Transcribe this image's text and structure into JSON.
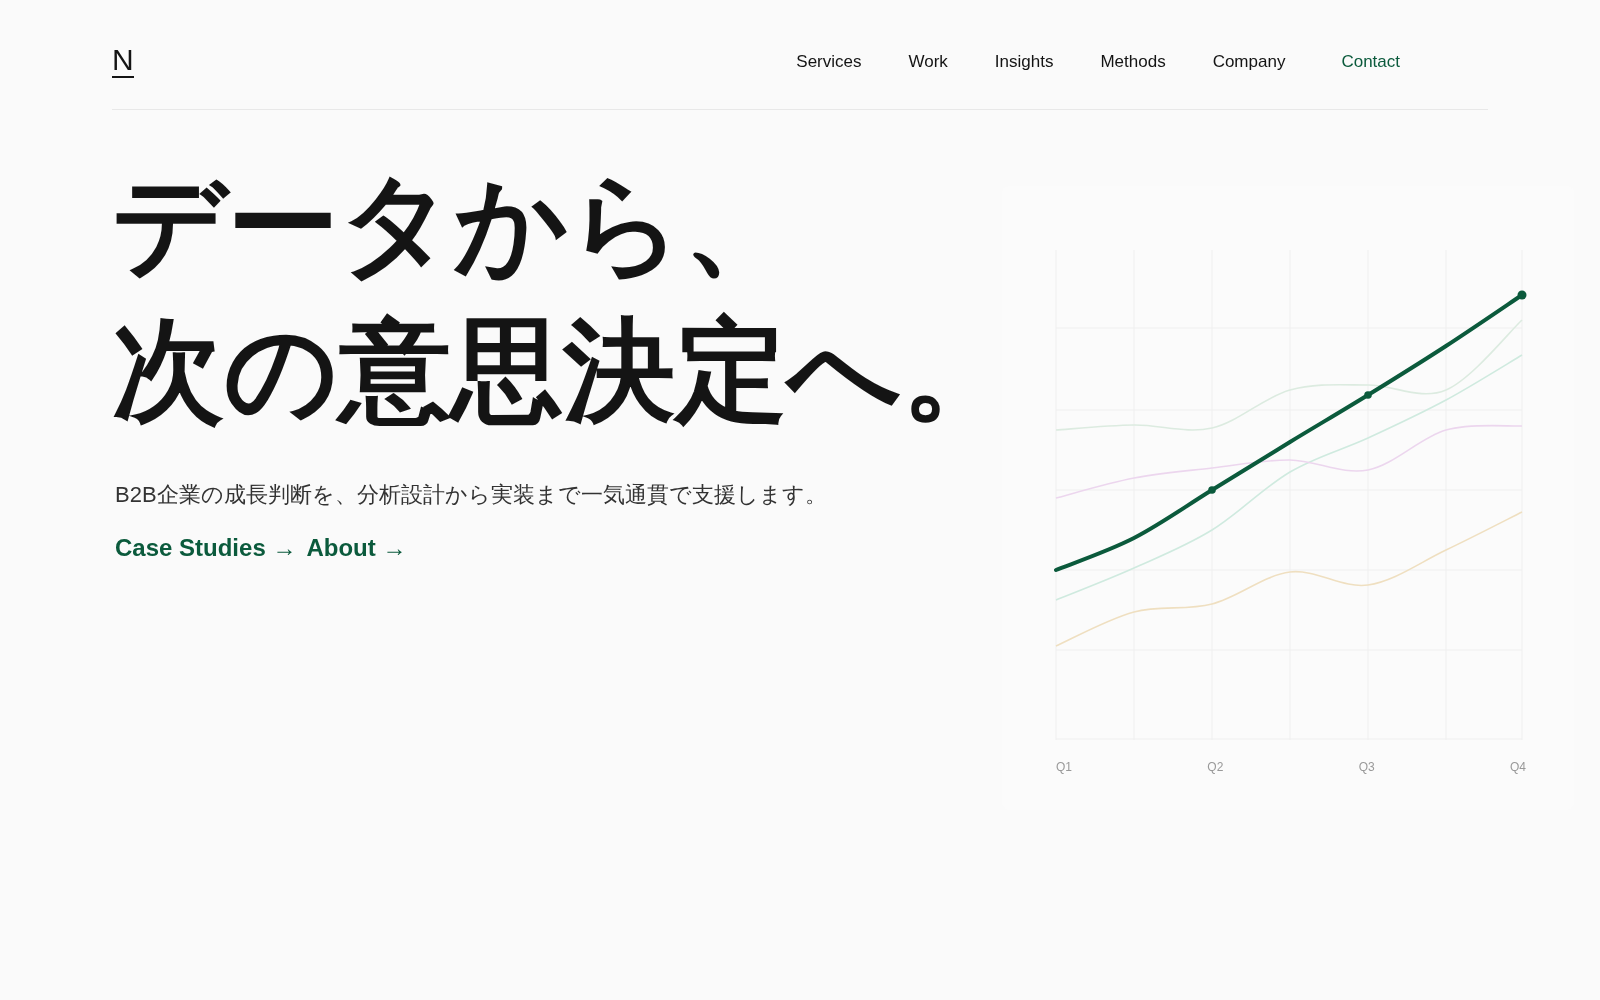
{
  "logo": "N",
  "nav": [
    {
      "label": "Services",
      "kind": "link"
    },
    {
      "label": "Work",
      "kind": "link"
    },
    {
      "label": "Insights",
      "kind": "link"
    },
    {
      "label": "Methods",
      "kind": "link"
    },
    {
      "label": "Company",
      "kind": "link"
    },
    {
      "label": "Contact",
      "kind": "cta"
    }
  ],
  "hero": {
    "headline": [
      "データから、",
      "次の意思決定へ。"
    ],
    "subtitle": "B2B企業の成長判断を、分析設計から実装まで一気通貫で支援します。",
    "links": [
      "Case Studies →",
      "About →"
    ]
  },
  "chart": {
    "x_labels": [
      "Q1",
      "Q2",
      "Q3",
      "Q4"
    ]
  }
}
